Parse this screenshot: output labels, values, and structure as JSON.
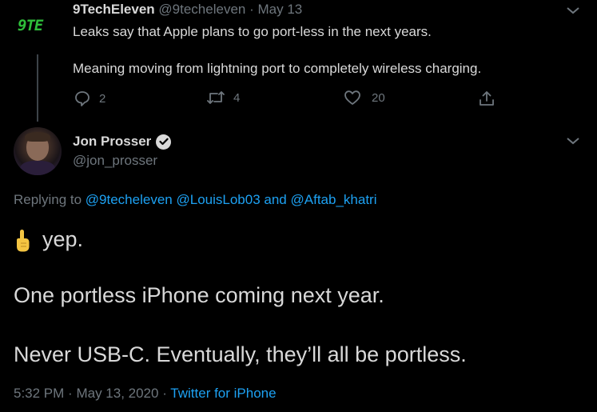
{
  "parent_tweet": {
    "logo_text": "9TE",
    "name": "9TechEleven",
    "handle": "@9techeleven",
    "separator": "·",
    "date": "May 13",
    "text_line1": "Leaks say that Apple plans to go port-less in the next years.",
    "text_line2": "Meaning moving from lightning port to completely wireless charging.",
    "reply_count": "2",
    "retweet_count": "4",
    "like_count": "20"
  },
  "main_tweet": {
    "name": "Jon Prosser",
    "handle": "@jon_prosser",
    "replying_prefix": "Replying to",
    "mention1": "@9techeleven",
    "mention2": "@LouisLob03",
    "and_word": "and",
    "mention3": "@Aftab_khatri",
    "line1": "yep.",
    "line2": "One portless iPhone coming next year.",
    "line3": "Never USB-C. Eventually, they’ll all be portless.",
    "time": "5:32 PM",
    "separator": "·",
    "date": "May 13, 2020",
    "source": "Twitter for iPhone"
  },
  "colors": {
    "background": "#000000",
    "text": "#d9d9d9",
    "secondary": "#6e767d",
    "link": "#1da1f2",
    "logo": "#2ebd3a"
  },
  "icons": [
    "9techeleven-logo",
    "chevron-down-icon",
    "reply-icon",
    "retweet-icon",
    "like-icon",
    "share-icon",
    "verified-badge-icon",
    "point-up-emoji"
  ]
}
